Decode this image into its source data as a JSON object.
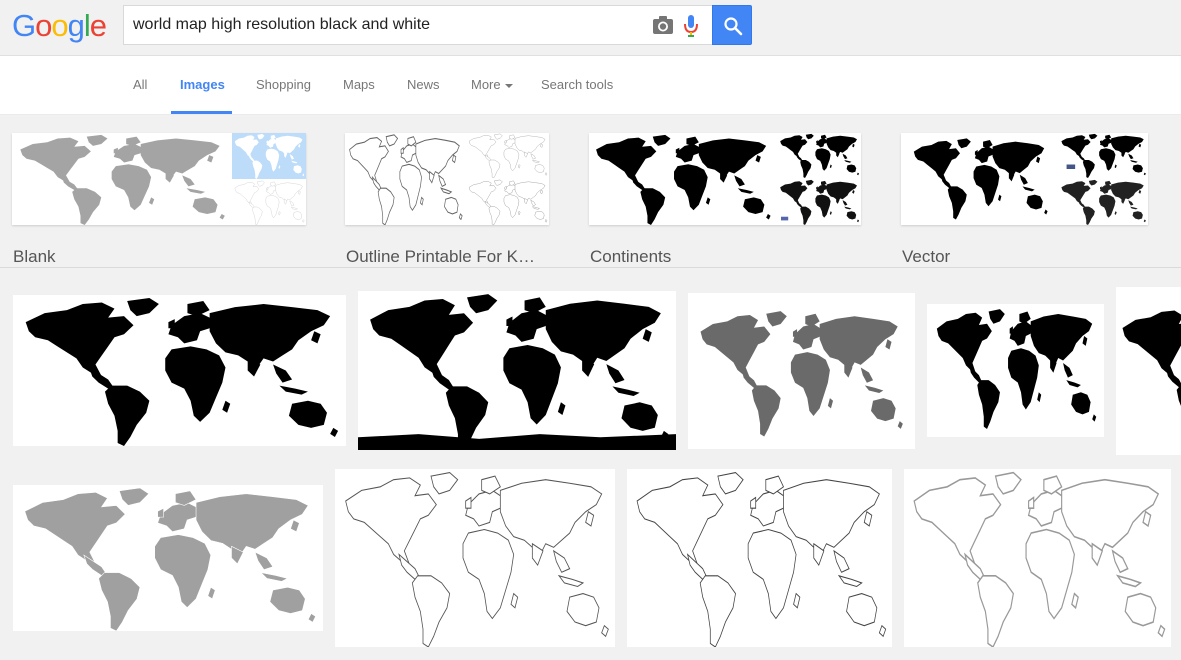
{
  "logo": {
    "letters": [
      "G",
      "o",
      "o",
      "g",
      "l",
      "e"
    ],
    "colors": [
      "#4285f4",
      "#ea4335",
      "#fbbc05",
      "#4285f4",
      "#34a853",
      "#ea4335"
    ]
  },
  "search": {
    "query": "world map high resolution black and white"
  },
  "icons": {
    "camera": "camera-icon",
    "mic": "microphone-icon",
    "search": "search-icon"
  },
  "tabs": [
    {
      "label": "All"
    },
    {
      "label": "Images"
    },
    {
      "label": "Shopping"
    },
    {
      "label": "Maps"
    },
    {
      "label": "News"
    },
    {
      "label": "More"
    },
    {
      "label": "Search tools"
    }
  ],
  "related": [
    {
      "label": "Blank"
    },
    {
      "label": "Outline Printable For K…"
    },
    {
      "label": "Continents"
    },
    {
      "label": "Vector"
    }
  ],
  "colors": {
    "accent": "#4285f4",
    "tab_text": "#777777",
    "label_text": "#555555"
  }
}
